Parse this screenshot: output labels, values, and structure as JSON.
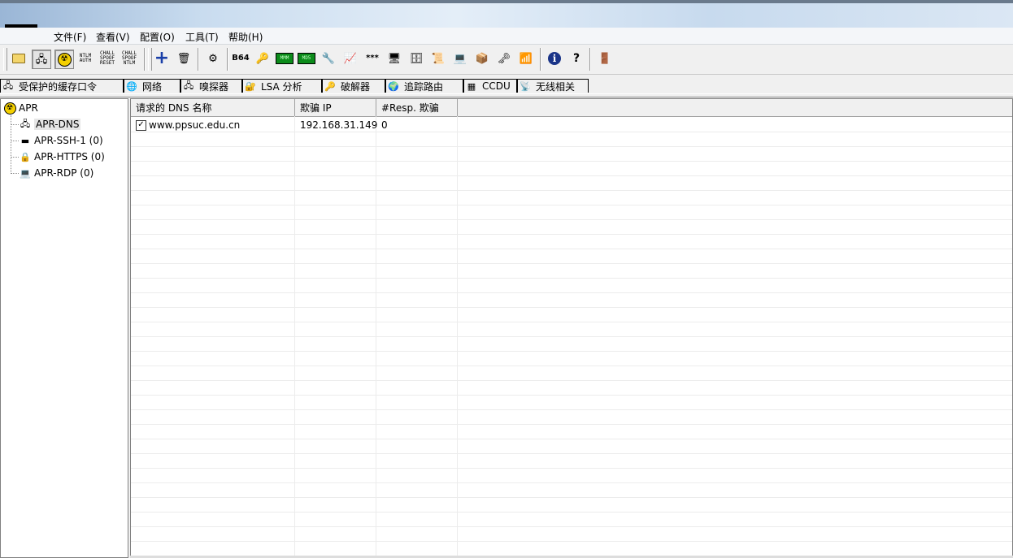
{
  "menu": [
    "文件(F)",
    "查看(V)",
    "配置(O)",
    "工具(T)",
    "帮助(H)"
  ],
  "toolbar": {
    "ntlm_auth": "NTLM AUTH",
    "chall_spoof_reset": "CHALL SPOOF RESET",
    "chall_spoof_ntlm": "CHALL SPOOF NTLM",
    "b64": "B64",
    "hash_a": "MMM",
    "hash_b": "MD5",
    "stars": "***"
  },
  "tabs": [
    "受保护的缓存口令",
    "网络",
    "嗅探器",
    "LSA 分析",
    "破解器",
    "追踪路由",
    "CCDU",
    "无线相关"
  ],
  "tree": {
    "root": "APR",
    "children": [
      "APR-DNS",
      "APR-SSH-1 (0)",
      "APR-HTTPS (0)",
      "APR-RDP (0)"
    ]
  },
  "list": {
    "columns": [
      "请求的 DNS 名称",
      "欺骗 IP",
      "#Resp. 欺骗"
    ],
    "rows": [
      {
        "checked": true,
        "name": "www.ppsuc.edu.cn",
        "ip": "192.168.31.149",
        "resp": "0"
      }
    ]
  }
}
